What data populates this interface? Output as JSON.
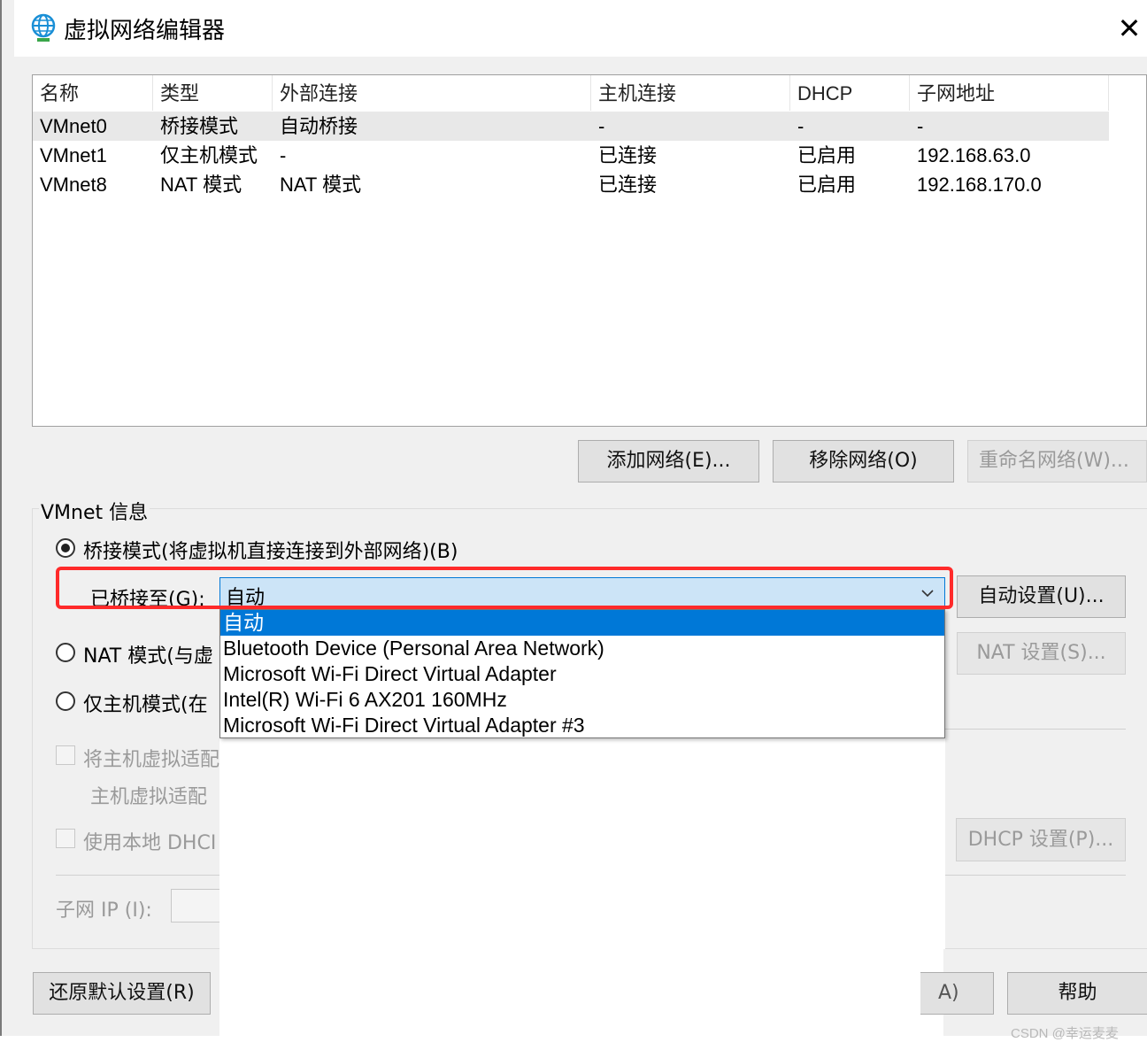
{
  "window": {
    "title": "虚拟网络编辑器",
    "close_label": "✕"
  },
  "table": {
    "columns": [
      "名称",
      "类型",
      "外部连接",
      "主机连接",
      "DHCP",
      "子网地址"
    ],
    "rows": [
      [
        "VMnet0",
        "桥接模式",
        "自动桥接",
        "-",
        "-",
        "-"
      ],
      [
        "VMnet1",
        "仅主机模式",
        "-",
        "已连接",
        "已启用",
        "192.168.63.0"
      ],
      [
        "VMnet8",
        "NAT 模式",
        "NAT 模式",
        "已连接",
        "已启用",
        "192.168.170.0"
      ]
    ],
    "selected_row": 0
  },
  "network_buttons": {
    "add": "添加网络(E)...",
    "remove": "移除网络(O)",
    "rename": "重命名网络(W)..."
  },
  "vmnet_info": {
    "group_label": "VMnet 信息",
    "bridged_label": "桥接模式(将虚拟机直接连接到外部网络)(B)",
    "bridged_to_label": "已桥接至(G):",
    "bridged_to_value": "自动",
    "auto_settings": "自动设置(U)...",
    "nat_label": "NAT 模式(与虚",
    "nat_settings": "NAT 设置(S)...",
    "hostonly_label": "仅主机模式(在",
    "connect_host_adapter": "将主机虚拟适配",
    "host_adapter_name": "主机虚拟适配",
    "use_dhcp": "使用本地 DHCI",
    "dhcp_settings": "DHCP 设置(P)...",
    "subnet_ip_label": "子网 IP (I):"
  },
  "dropdown": {
    "options": [
      "自动",
      "Bluetooth Device (Personal Area Network)",
      "Microsoft Wi-Fi Direct Virtual Adapter",
      "Intel(R) Wi-Fi 6 AX201 160MHz",
      "Microsoft Wi-Fi Direct Virtual Adapter #3"
    ],
    "selected_index": 0
  },
  "bottom_buttons": {
    "restore": "还原默认设置(R)",
    "apply_partial": "A)",
    "help": "帮助"
  },
  "watermark": "CSDN @幸运麦麦",
  "colors": {
    "accent": "#0078d7",
    "highlight": "#ff2a2a",
    "combo_bg": "#cce4f7"
  },
  "icons": {
    "app": "globe-network-icon",
    "close": "close-icon",
    "dropdown": "chevron-down-icon"
  }
}
